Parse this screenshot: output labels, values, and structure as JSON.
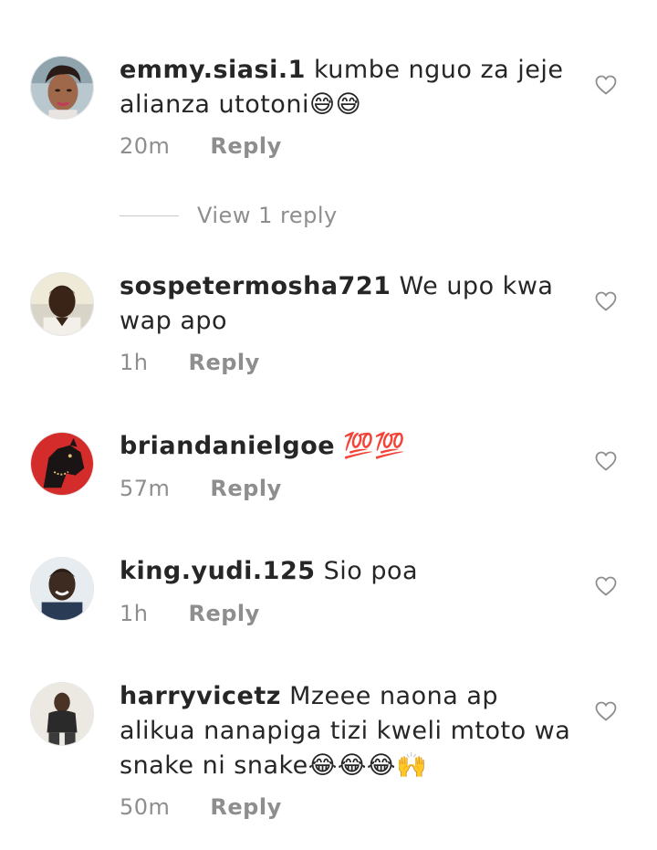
{
  "comments": [
    {
      "username": "emmy.siasi.1",
      "text": "kumbe nguo za jeje alianza utotoni😅😅",
      "time": "20m",
      "reply": "Reply"
    },
    {
      "username": "sospetermosha721",
      "text": "We upo kwa wap apo",
      "time": "1h",
      "reply": "Reply"
    },
    {
      "username": "briandanielgoe",
      "text": "💯💯",
      "time": "57m",
      "reply": "Reply"
    },
    {
      "username": "king.yudi.125",
      "text": "Sio poa",
      "time": "1h",
      "reply": "Reply"
    },
    {
      "username": "harryvicetz",
      "text": "Mzeee naona ap alikua nanapiga tizi kweli mtoto wa snake ni snake😂😂😂🙌",
      "time": "50m",
      "reply": "Reply"
    }
  ],
  "view_replies": {
    "label": "View 1 reply"
  },
  "icons": {
    "like": "heart-outline-icon"
  },
  "colors": {
    "text": "#262626",
    "secondary": "#8e8e8e",
    "divider": "#c7c7c7"
  }
}
